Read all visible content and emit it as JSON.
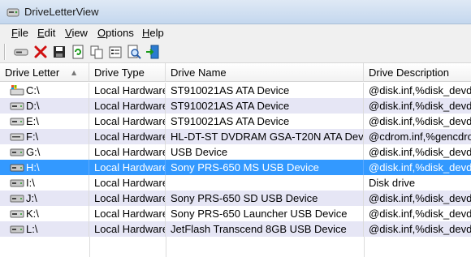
{
  "window": {
    "title": "DriveLetterView"
  },
  "menu": {
    "items": [
      {
        "accel": "F",
        "rest": "ile"
      },
      {
        "accel": "E",
        "rest": "dit"
      },
      {
        "accel": "V",
        "rest": "iew"
      },
      {
        "accel": "O",
        "rest": "ptions"
      },
      {
        "accel": "H",
        "rest": "elp"
      }
    ]
  },
  "toolbar": {
    "buttons": [
      "drive-icon",
      "delete-icon",
      "save-icon",
      "refresh-icon",
      "copy-icon",
      "properties-icon",
      "find-icon",
      "exit-icon"
    ]
  },
  "table": {
    "columns": [
      "Drive Letter",
      "Drive Type",
      "Drive Name",
      "Drive Description"
    ],
    "rows": [
      {
        "letter": "C:\\",
        "type": "Local Hardware",
        "name": "ST910021AS ATA Device",
        "desc": "@disk.inf,%disk_devdesc"
      },
      {
        "letter": "D:\\",
        "type": "Local Hardware",
        "name": "ST910021AS ATA Device",
        "desc": "@disk.inf,%disk_devdesc"
      },
      {
        "letter": "E:\\",
        "type": "Local Hardware",
        "name": "ST910021AS ATA Device",
        "desc": "@disk.inf,%disk_devdesc"
      },
      {
        "letter": "F:\\",
        "type": "Local Hardware",
        "name": "HL-DT-ST DVDRAM GSA-T20N ATA Device",
        "desc": "@cdrom.inf,%gencdrom"
      },
      {
        "letter": "G:\\",
        "type": "Local Hardware",
        "name": "USB Device",
        "desc": "@disk.inf,%disk_devdesc"
      },
      {
        "letter": "H:\\",
        "type": "Local Hardware",
        "name": "Sony PRS-650 MS USB Device",
        "desc": "@disk.inf,%disk_devdesc"
      },
      {
        "letter": "I:\\",
        "type": "Local Hardware",
        "name": "",
        "desc": "Disk drive"
      },
      {
        "letter": "J:\\",
        "type": "Local Hardware",
        "name": "Sony PRS-650 SD USB Device",
        "desc": "@disk.inf,%disk_devdesc"
      },
      {
        "letter": "K:\\",
        "type": "Local Hardware",
        "name": "Sony PRS-650 Launcher USB Device",
        "desc": "@disk.inf,%disk_devdesc"
      },
      {
        "letter": "L:\\",
        "type": "Local Hardware",
        "name": "JetFlash Transcend 8GB USB Device",
        "desc": "@disk.inf,%disk_devdesc"
      }
    ],
    "selected_index": 5
  },
  "colors": {
    "selection": "#3399ff",
    "alt_row": "#e6e6f5"
  }
}
